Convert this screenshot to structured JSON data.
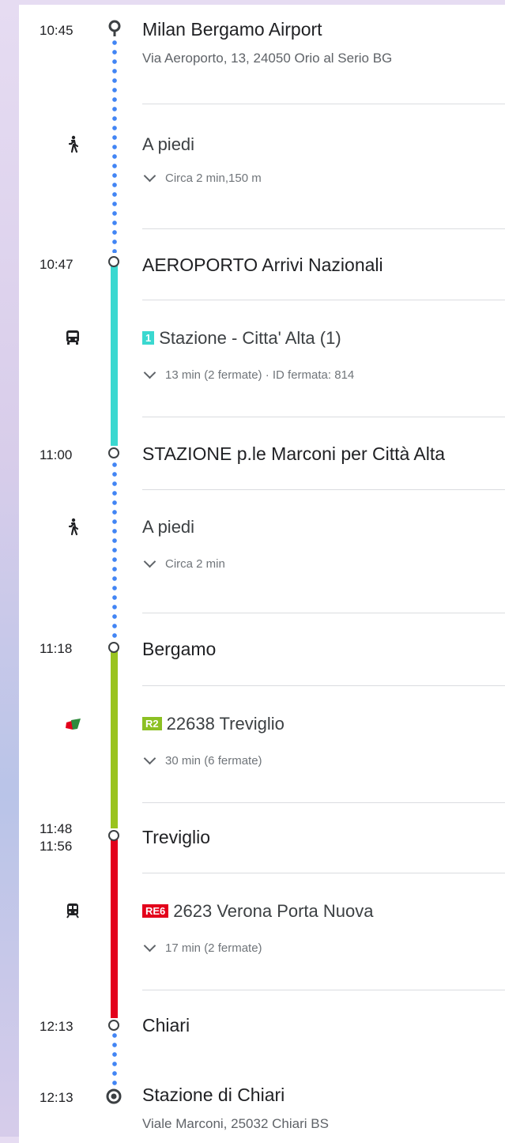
{
  "colors": {
    "walk_dots": "#4285f4",
    "bus_line": "#3ad8d0",
    "r2_line": "#9ac31f",
    "re6_line": "#e3001b",
    "badge_1": "#3ad8d0",
    "badge_r2": "#8cc023",
    "badge_re6": "#e3001b"
  },
  "icons": {
    "walk": "walking-person-icon",
    "bus": "bus-icon",
    "train_logo": "trenord-logo-icon",
    "train": "train-icon",
    "origin": "origin-pin-icon",
    "destination": "destination-target-icon"
  },
  "origin": {
    "time": "10:45",
    "name": "Milan Bergamo Airport",
    "address": "Via Aeroporto, 13, 24050 Orio al Serio BG"
  },
  "walk1": {
    "label": "A piedi",
    "detail": "Circa 2 min,150 m"
  },
  "stop1": {
    "time": "10:47",
    "name": "AEROPORTO Arrivi Nazionali"
  },
  "bus": {
    "badge": "1",
    "line": "Stazione - Citta' Alta (1)",
    "detail": "13 min (2 fermate) · ID fermata: 814"
  },
  "stop2": {
    "time": "11:00",
    "name": "STAZIONE p.le Marconi per Città Alta"
  },
  "walk2": {
    "label": "A piedi",
    "detail": "Circa 2 min"
  },
  "stop3": {
    "time": "11:18",
    "name": "Bergamo"
  },
  "train1": {
    "badge": "R2",
    "line": "22638 Treviglio",
    "detail": "30 min (6 fermate)"
  },
  "stop4": {
    "time_arrive": "11:48",
    "time_depart": "11:56",
    "name": "Treviglio"
  },
  "train2": {
    "badge": "RE6",
    "line": "2623 Verona Porta Nuova",
    "detail": "17 min (2 fermate)"
  },
  "stop5": {
    "time": "12:13",
    "name": "Chiari"
  },
  "destination": {
    "time": "12:13",
    "name": "Stazione di Chiari",
    "address": "Viale Marconi, 25032 Chiari BS"
  }
}
